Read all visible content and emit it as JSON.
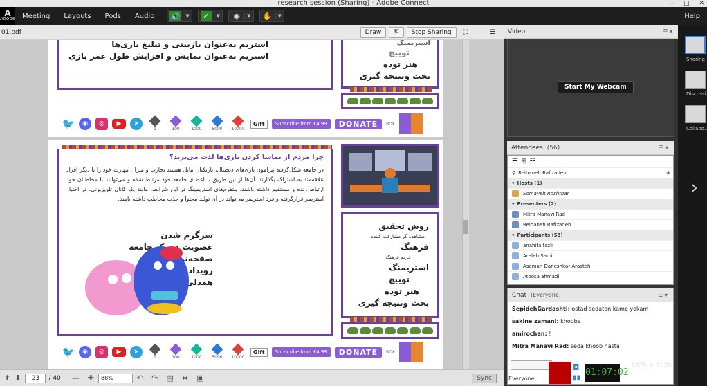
{
  "window": {
    "title": "research session (Sharing) - Adobe Connect"
  },
  "menubar": {
    "logo_text": "Adobe",
    "items": [
      "Meeting",
      "Layouts",
      "Pods",
      "Audio"
    ],
    "help": "Help"
  },
  "share": {
    "filename": "01.pdf",
    "draw": "Draw",
    "stop_sharing": "Stop Sharing"
  },
  "slide_top": {
    "bullets": [
      "استریم به‌عنوان بازبینی و تبلیغ بازی‌ها",
      "استریم به‌عنوان نمایش و افزایش طول عمر بازی"
    ],
    "side_items": [
      "استریمنگ",
      "توییچ",
      "هنر توده",
      "بحث ونتیجه گیری"
    ]
  },
  "social_bar": {
    "gems": [
      {
        "n": "1",
        "c": "#555555"
      },
      {
        "n": "100",
        "c": "#8a5cd6"
      },
      {
        "n": "1000",
        "c": "#1bb39a"
      },
      {
        "n": "5000",
        "c": "#2a7ad6"
      },
      {
        "n": "10000",
        "c": "#e0403a"
      }
    ],
    "gift": "Gift",
    "subscribe": "Subscribe from £4.99",
    "donate": "DONATE",
    "box": "BOX"
  },
  "slide_main": {
    "question": "چرا مردم از تماشا کردن بازی‌ها لذت می‌برند؟",
    "paragraph": "در جامعه شکل‌گرفته پیرامون بازی‌های دیجیتال، بازیکنان مایل هستند تجارب و میزان مهارت خود را با دیگر افراد علاقه‌مند به اشتراک بگذارند. آن‌ها از این طریق با اعضای جامعه خود مرتبط شده و می‌توانند با مخاطبان خود ارتباط زنده و مستقیم داشته باشند. پلتفرم‌های استریمینگ در این شرایط، مانند یک کانال تلویزیونی، در اختیار استریمر قرارگرفته و فرد استریمر می‌تواند در آن تولید محتوا و جذب مخاطب داشته باشد.",
    "bullets": [
      "سرگرم شدن",
      "عضویت در یک جامعه",
      "صفحه‌نمایش دوم",
      "رویداد پخش زنده",
      "همدلی با استریمرها"
    ],
    "side": {
      "title1": "روش تحقیق",
      "sub1": "مشاهده گر مشارکت کننده",
      "title2": "فرهنگ",
      "sub2": "خرده فرهنگ",
      "title3": "استریمنگ",
      "sub3": "توییچ",
      "title4": "هنر توده",
      "title5": "بحث ونتیجه گیری"
    }
  },
  "bottombar": {
    "page": "23",
    "total": "/ 40",
    "zoom": "88%",
    "sync": "Sync"
  },
  "video": {
    "title": "Video",
    "webcam": "Start My Webcam"
  },
  "attendees": {
    "title": "Attendees",
    "count": "(56)",
    "search_value": "Reihaneh Rafizadeh",
    "groups": [
      {
        "label": "Hosts (1)",
        "people": [
          "Somayeh Roshtbar"
        ]
      },
      {
        "label": "Presenters (2)",
        "people": [
          "Mitra Manavi Rad",
          "Reihaneh Rafizadeh"
        ]
      },
      {
        "label": "Participants (53)",
        "people": [
          "anahita fazli",
          "Arefeh Sami",
          "Aseman Daneshkar Arasteh",
          "Atoosa ahmadi"
        ]
      }
    ]
  },
  "chat": {
    "title": "Chat",
    "scope": "(Everyone)",
    "messages": [
      {
        "from": "SepidehGardashti:",
        "text": "ostad sedaton kame yekam"
      },
      {
        "from": "sakine zamani:",
        "text": "khoobe"
      },
      {
        "from": "amirochan:",
        "text": "!"
      },
      {
        "from": "Mitra Manavi Rad:",
        "text": "seda khoob hasta"
      }
    ],
    "to": "Everyone"
  },
  "rail": {
    "layouts": [
      "Sharing",
      "Discussi...",
      "Collabo..."
    ]
  },
  "recorder": {
    "time": "01:07:02",
    "dims": "1875 × 1020"
  },
  "colors": {
    "accent": "#6b3f9e",
    "donate": "#8a5cd6",
    "rec": "#bb0000"
  }
}
